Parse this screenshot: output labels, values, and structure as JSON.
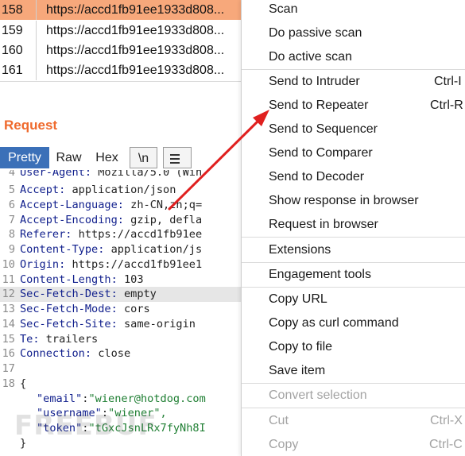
{
  "history": {
    "rows": [
      {
        "num": "158",
        "url": "https://accd1fb91ee1933d808..."
      },
      {
        "num": "159",
        "url": "https://accd1fb91ee1933d808..."
      },
      {
        "num": "160",
        "url": "https://accd1fb91ee1933d808..."
      },
      {
        "num": "161",
        "url": "https://accd1fb91ee1933d808..."
      }
    ]
  },
  "request": {
    "title": "Request",
    "tabs": {
      "pretty": "Pretty",
      "raw": "Raw",
      "hex": "Hex",
      "newline": "\\n"
    },
    "lines": [
      {
        "n": "4",
        "k": "User-Agent:",
        "v": " Mozilla/5.0 (Win"
      },
      {
        "n": "5",
        "k": "Accept:",
        "v": " application/json"
      },
      {
        "n": "6",
        "k": "Accept-Language:",
        "v": " zh-CN,zh;q="
      },
      {
        "n": "7",
        "k": "Accept-Encoding:",
        "v": " gzip, defla"
      },
      {
        "n": "8",
        "k": "Referer:",
        "v": " https://accd1fb91ee"
      },
      {
        "n": "9",
        "k": "Content-Type:",
        "v": " application/js"
      },
      {
        "n": "10",
        "k": "Origin:",
        "v": " https://accd1fb91ee1"
      },
      {
        "n": "11",
        "k": "Content-Length:",
        "v": " 103"
      },
      {
        "n": "12",
        "k": "Sec-Fetch-Dest:",
        "v": " empty"
      },
      {
        "n": "13",
        "k": "Sec-Fetch-Mode:",
        "v": " cors"
      },
      {
        "n": "14",
        "k": "Sec-Fetch-Site:",
        "v": " same-origin"
      },
      {
        "n": "15",
        "k": "Te:",
        "v": " trailers"
      },
      {
        "n": "16",
        "k": "Connection:",
        "v": " close"
      },
      {
        "n": "17",
        "k": "",
        "v": ""
      },
      {
        "n": "18",
        "k": "",
        "v": "{"
      }
    ],
    "json": [
      {
        "key": "\"email\"",
        "sep": ":",
        "val": "\"wiener@hotdog.com"
      },
      {
        "key": "\"username\"",
        "sep": ":",
        "val": "\"wiener\","
      },
      {
        "key": "\"token\"",
        "sep": ":",
        "val": "\"tGxcJsnLRx7fyNh8I"
      }
    ],
    "closing": "}"
  },
  "watermark": "FREEBUF",
  "context_menu": {
    "scan": "Scan",
    "passive_scan": "Do passive scan",
    "active_scan": "Do active scan",
    "intruder": "Send to Intruder",
    "intruder_shortcut": "Ctrl-I",
    "repeater": "Send to Repeater",
    "repeater_shortcut": "Ctrl-R",
    "sequencer": "Send to Sequencer",
    "comparer": "Send to Comparer",
    "decoder": "Send to Decoder",
    "show_response": "Show response in browser",
    "request_browser": "Request in browser",
    "extensions": "Extensions",
    "engagement": "Engagement tools",
    "copy_url": "Copy URL",
    "copy_curl": "Copy as curl command",
    "copy_file": "Copy to file",
    "save_item": "Save item",
    "convert": "Convert selection",
    "cut": "Cut",
    "cut_shortcut": "Ctrl-X",
    "copy": "Copy",
    "copy_shortcut": "Ctrl-C"
  },
  "colors": {
    "selected_row": "#f7a87b",
    "accent_title": "#ef6a2d",
    "active_tab": "#3b70b8",
    "arrow": "#e0201f",
    "json_key": "#0f1e8c",
    "json_value": "#1e7e32"
  }
}
